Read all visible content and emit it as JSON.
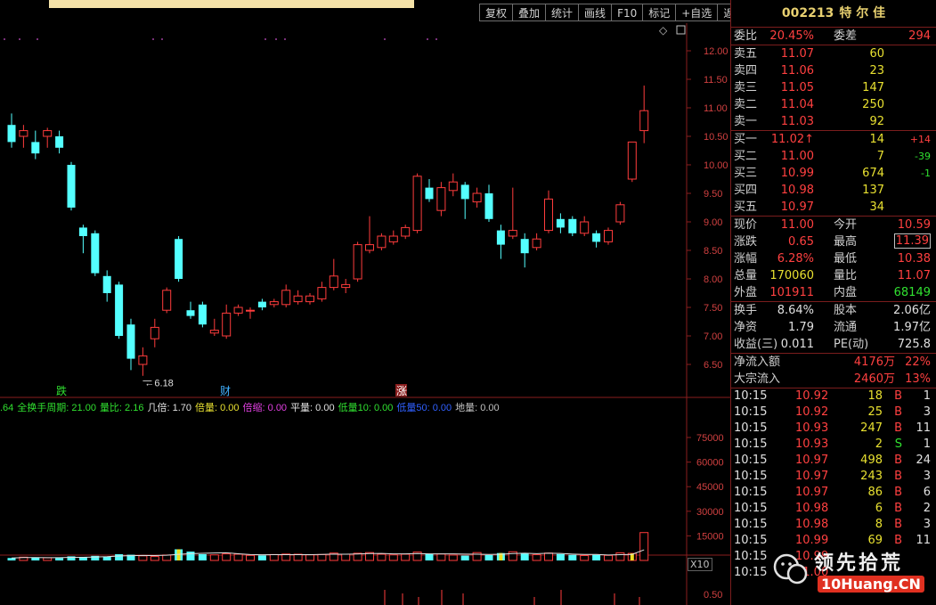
{
  "toolbar": {
    "buttons": [
      "复权",
      "叠加",
      "统计",
      "画线",
      "F10",
      "标记",
      "+自选",
      "返回"
    ]
  },
  "price_axis": [
    "12.00",
    "11.50",
    "11.00",
    "10.50",
    "10.00",
    "9.50",
    "9.00",
    "8.50",
    "8.00",
    "7.50",
    "7.00",
    "6.50"
  ],
  "volume_axis": [
    "75000",
    "60000",
    "45000",
    "30000",
    "15000"
  ],
  "macd_axis": [
    "0.50"
  ],
  "annotations": {
    "low_label": "6.18",
    "event_die": "跌",
    "event_cai": "财",
    "event_zhang": "涨"
  },
  "indicator": [
    {
      "text": ".64",
      "color": "#30e030"
    },
    {
      "text": "全换手周期: 21.00",
      "color": "#30e030"
    },
    {
      "text": "量比: 2.16",
      "color": "#30e030"
    },
    {
      "text": "几倍: 1.70",
      "color": "#e0e0e0"
    },
    {
      "text": "倍量: 0.00",
      "color": "#e8e030"
    },
    {
      "text": "倍缩: 0.00",
      "color": "#e040e0"
    },
    {
      "text": "平量: 0.00",
      "color": "#e0e0e0"
    },
    {
      "text": "低量10: 0.00",
      "color": "#30e030"
    },
    {
      "text": "低量50: 0.00",
      "color": "#3060ff"
    },
    {
      "text": "地量: 0.00",
      "color": "#c0c0c0"
    }
  ],
  "x10_label": "X10",
  "stock": {
    "code": "002213",
    "name": "特 尔 佳"
  },
  "order": {
    "weibi_label": "委比",
    "weibi": "20.45%",
    "weicha_label": "委差",
    "weicha": "294"
  },
  "asks": [
    {
      "label": "卖五",
      "price": "11.07",
      "qty": "60"
    },
    {
      "label": "卖四",
      "price": "11.06",
      "qty": "23"
    },
    {
      "label": "卖三",
      "price": "11.05",
      "qty": "147"
    },
    {
      "label": "卖二",
      "price": "11.04",
      "qty": "250"
    },
    {
      "label": "卖一",
      "price": "11.03",
      "qty": "92"
    }
  ],
  "bids": [
    {
      "label": "买一",
      "price": "11.02↑",
      "qty": "14",
      "delta": "+14",
      "dcolor": "red"
    },
    {
      "label": "买二",
      "price": "11.00",
      "qty": "7",
      "delta": "-39",
      "dcolor": "grn"
    },
    {
      "label": "买三",
      "price": "10.99",
      "qty": "674",
      "delta": "-1",
      "dcolor": "grn"
    },
    {
      "label": "买四",
      "price": "10.98",
      "qty": "137",
      "delta": "",
      "dcolor": "grn"
    },
    {
      "label": "买五",
      "price": "10.97",
      "qty": "34",
      "delta": "",
      "dcolor": "grn"
    }
  ],
  "quote": [
    {
      "l": "现价",
      "v": "11.00",
      "vc": "red",
      "l2": "今开",
      "v2": "10.59",
      "v2c": "red"
    },
    {
      "l": "涨跌",
      "v": "0.65",
      "vc": "red",
      "l2": "最高",
      "v2": "11.39",
      "v2c": "red"
    },
    {
      "l": "涨幅",
      "v": "6.28%",
      "vc": "red",
      "l2": "最低",
      "v2": "10.38",
      "v2c": "red"
    },
    {
      "l": "总量",
      "v": "170060",
      "vc": "yel",
      "l2": "量比",
      "v2": "11.07",
      "v2c": "red"
    },
    {
      "l": "外盘",
      "v": "101911",
      "vc": "red",
      "l2": "内盘",
      "v2": "68149",
      "v2c": "grn"
    }
  ],
  "fundamentals": [
    {
      "l": "换手",
      "v": "8.64%",
      "l2": "股本",
      "v2": "2.06亿"
    },
    {
      "l": "净资",
      "v": "1.79",
      "l2": "流通",
      "v2": "1.97亿"
    },
    {
      "l": "收益(三)",
      "v": "0.011",
      "l2": "PE(动)",
      "v2": "725.8"
    }
  ],
  "flows": [
    {
      "l": "净流入额",
      "v": "4176万",
      "p": "22%"
    },
    {
      "l": "大宗流入",
      "v": "2460万",
      "p": "13%"
    }
  ],
  "ticks": [
    {
      "t": "10:15",
      "p": "10.92",
      "q": "18",
      "f": "B",
      "fc": "red",
      "n": "1"
    },
    {
      "t": "10:15",
      "p": "10.92",
      "q": "25",
      "f": "B",
      "fc": "red",
      "n": "3"
    },
    {
      "t": "10:15",
      "p": "10.93",
      "q": "247",
      "f": "B",
      "fc": "red",
      "n": "11"
    },
    {
      "t": "10:15",
      "p": "10.93",
      "q": "2",
      "f": "S",
      "fc": "grn",
      "n": "1"
    },
    {
      "t": "10:15",
      "p": "10.97",
      "q": "498",
      "f": "B",
      "fc": "red",
      "n": "24"
    },
    {
      "t": "10:15",
      "p": "10.97",
      "q": "243",
      "f": "B",
      "fc": "red",
      "n": "3"
    },
    {
      "t": "10:15",
      "p": "10.97",
      "q": "86",
      "f": "B",
      "fc": "red",
      "n": "6"
    },
    {
      "t": "10:15",
      "p": "10.98",
      "q": "6",
      "f": "B",
      "fc": "red",
      "n": "2"
    },
    {
      "t": "10:15",
      "p": "10.98",
      "q": "8",
      "f": "B",
      "fc": "red",
      "n": "3"
    },
    {
      "t": "10:15",
      "p": "10.99",
      "q": "69",
      "f": "B",
      "fc": "red",
      "n": "11"
    },
    {
      "t": "10:15",
      "p": "10.99",
      "q": "",
      "f": "",
      "fc": "red",
      "n": ""
    },
    {
      "t": "10:15",
      "p": "11.00",
      "q": "",
      "f": "",
      "fc": "red",
      "n": ""
    }
  ],
  "watermark": {
    "text": "领先拾荒",
    "sub": "10Huang.CN"
  },
  "chart_data": {
    "type": "candlestick",
    "price_range": [
      6.2,
      12.3
    ],
    "candles": [
      {
        "o": 10.7,
        "c": 10.4,
        "h": 10.9,
        "l": 10.3
      },
      {
        "o": 10.5,
        "c": 10.6,
        "h": 10.7,
        "l": 10.3
      },
      {
        "o": 10.4,
        "c": 10.2,
        "h": 10.6,
        "l": 10.1
      },
      {
        "o": 10.5,
        "c": 10.6,
        "h": 10.65,
        "l": 10.3
      },
      {
        "o": 10.5,
        "c": 10.3,
        "h": 10.6,
        "l": 10.2
      },
      {
        "o": 10.0,
        "c": 9.25,
        "h": 10.05,
        "l": 9.2
      },
      {
        "o": 8.9,
        "c": 8.75,
        "h": 8.95,
        "l": 8.45
      },
      {
        "o": 8.8,
        "c": 8.1,
        "h": 8.85,
        "l": 8.05
      },
      {
        "o": 8.05,
        "c": 7.75,
        "h": 8.15,
        "l": 7.6
      },
      {
        "o": 7.9,
        "c": 7.0,
        "h": 7.95,
        "l": 6.95
      },
      {
        "o": 7.2,
        "c": 6.6,
        "h": 7.3,
        "l": 6.4
      },
      {
        "o": 6.5,
        "c": 6.65,
        "h": 6.8,
        "l": 6.3
      },
      {
        "o": 6.95,
        "c": 7.15,
        "h": 7.3,
        "l": 6.8
      },
      {
        "o": 7.45,
        "c": 7.8,
        "h": 7.85,
        "l": 7.4
      },
      {
        "o": 8.7,
        "c": 8.0,
        "h": 8.75,
        "l": 7.95
      },
      {
        "o": 7.45,
        "c": 7.35,
        "h": 7.6,
        "l": 7.3
      },
      {
        "o": 7.55,
        "c": 7.2,
        "h": 7.6,
        "l": 7.15
      },
      {
        "o": 7.05,
        "c": 7.1,
        "h": 7.3,
        "l": 7.0
      },
      {
        "o": 7.0,
        "c": 7.4,
        "h": 7.55,
        "l": 6.95
      },
      {
        "o": 7.4,
        "c": 7.5,
        "h": 7.55,
        "l": 7.35
      },
      {
        "o": 7.45,
        "c": 7.45,
        "h": 7.5,
        "l": 7.3
      },
      {
        "o": 7.6,
        "c": 7.5,
        "h": 7.65,
        "l": 7.45
      },
      {
        "o": 7.55,
        "c": 7.6,
        "h": 7.65,
        "l": 7.5
      },
      {
        "o": 7.55,
        "c": 7.8,
        "h": 7.9,
        "l": 7.5
      },
      {
        "o": 7.6,
        "c": 7.7,
        "h": 7.8,
        "l": 7.55
      },
      {
        "o": 7.6,
        "c": 7.7,
        "h": 7.75,
        "l": 7.55
      },
      {
        "o": 7.65,
        "c": 7.85,
        "h": 7.95,
        "l": 7.6
      },
      {
        "o": 7.85,
        "c": 8.05,
        "h": 8.35,
        "l": 7.8
      },
      {
        "o": 7.85,
        "c": 7.9,
        "h": 8.0,
        "l": 7.75
      },
      {
        "o": 8.0,
        "c": 8.6,
        "h": 8.65,
        "l": 7.95
      },
      {
        "o": 8.5,
        "c": 8.6,
        "h": 9.1,
        "l": 8.45
      },
      {
        "o": 8.55,
        "c": 8.75,
        "h": 8.8,
        "l": 8.5
      },
      {
        "o": 8.65,
        "c": 8.75,
        "h": 8.85,
        "l": 8.6
      },
      {
        "o": 8.75,
        "c": 8.9,
        "h": 8.95,
        "l": 8.7
      },
      {
        "o": 8.85,
        "c": 9.8,
        "h": 9.85,
        "l": 8.8
      },
      {
        "o": 9.6,
        "c": 9.4,
        "h": 9.75,
        "l": 9.35
      },
      {
        "o": 9.2,
        "c": 9.6,
        "h": 9.7,
        "l": 9.1
      },
      {
        "o": 9.55,
        "c": 9.7,
        "h": 9.85,
        "l": 9.45
      },
      {
        "o": 9.65,
        "c": 9.4,
        "h": 9.7,
        "l": 9.05
      },
      {
        "o": 9.35,
        "c": 9.5,
        "h": 9.6,
        "l": 9.25
      },
      {
        "o": 9.5,
        "c": 9.05,
        "h": 9.65,
        "l": 9.0
      },
      {
        "o": 8.85,
        "c": 8.6,
        "h": 8.95,
        "l": 8.35
      },
      {
        "o": 8.75,
        "c": 8.85,
        "h": 9.6,
        "l": 8.7
      },
      {
        "o": 8.7,
        "c": 8.45,
        "h": 8.8,
        "l": 8.2
      },
      {
        "o": 8.55,
        "c": 8.7,
        "h": 8.8,
        "l": 8.5
      },
      {
        "o": 8.85,
        "c": 9.4,
        "h": 9.55,
        "l": 8.8
      },
      {
        "o": 9.05,
        "c": 8.9,
        "h": 9.15,
        "l": 8.8
      },
      {
        "o": 9.05,
        "c": 8.8,
        "h": 9.1,
        "l": 8.75
      },
      {
        "o": 8.8,
        "c": 9.0,
        "h": 9.1,
        "l": 8.75
      },
      {
        "o": 8.8,
        "c": 8.65,
        "h": 8.85,
        "l": 8.55
      },
      {
        "o": 8.65,
        "c": 8.85,
        "h": 8.9,
        "l": 8.6
      },
      {
        "o": 9.0,
        "c": 9.3,
        "h": 9.35,
        "l": 8.95
      },
      {
        "o": 9.75,
        "c": 10.4,
        "h": 10.4,
        "l": 9.7
      },
      {
        "o": 10.6,
        "c": 10.95,
        "h": 11.39,
        "l": 10.38
      }
    ],
    "volumes": [
      1500,
      2000,
      1800,
      1600,
      1500,
      2500,
      2200,
      2800,
      2400,
      3800,
      3500,
      2800,
      2400,
      3300,
      6800,
      5400,
      3800,
      3400,
      4000,
      3800,
      3100,
      3100,
      3600,
      3900,
      3800,
      3400,
      3600,
      4500,
      3800,
      4400,
      4800,
      3800,
      3400,
      3800,
      5100,
      4000,
      3900,
      3300,
      3000,
      4800,
      3300,
      4500,
      5300,
      4200,
      3500,
      4500,
      3900,
      3400,
      3000,
      3400,
      3100,
      4600,
      4300,
      17000
    ],
    "highlight_volumes": [
      14,
      41,
      52
    ]
  }
}
